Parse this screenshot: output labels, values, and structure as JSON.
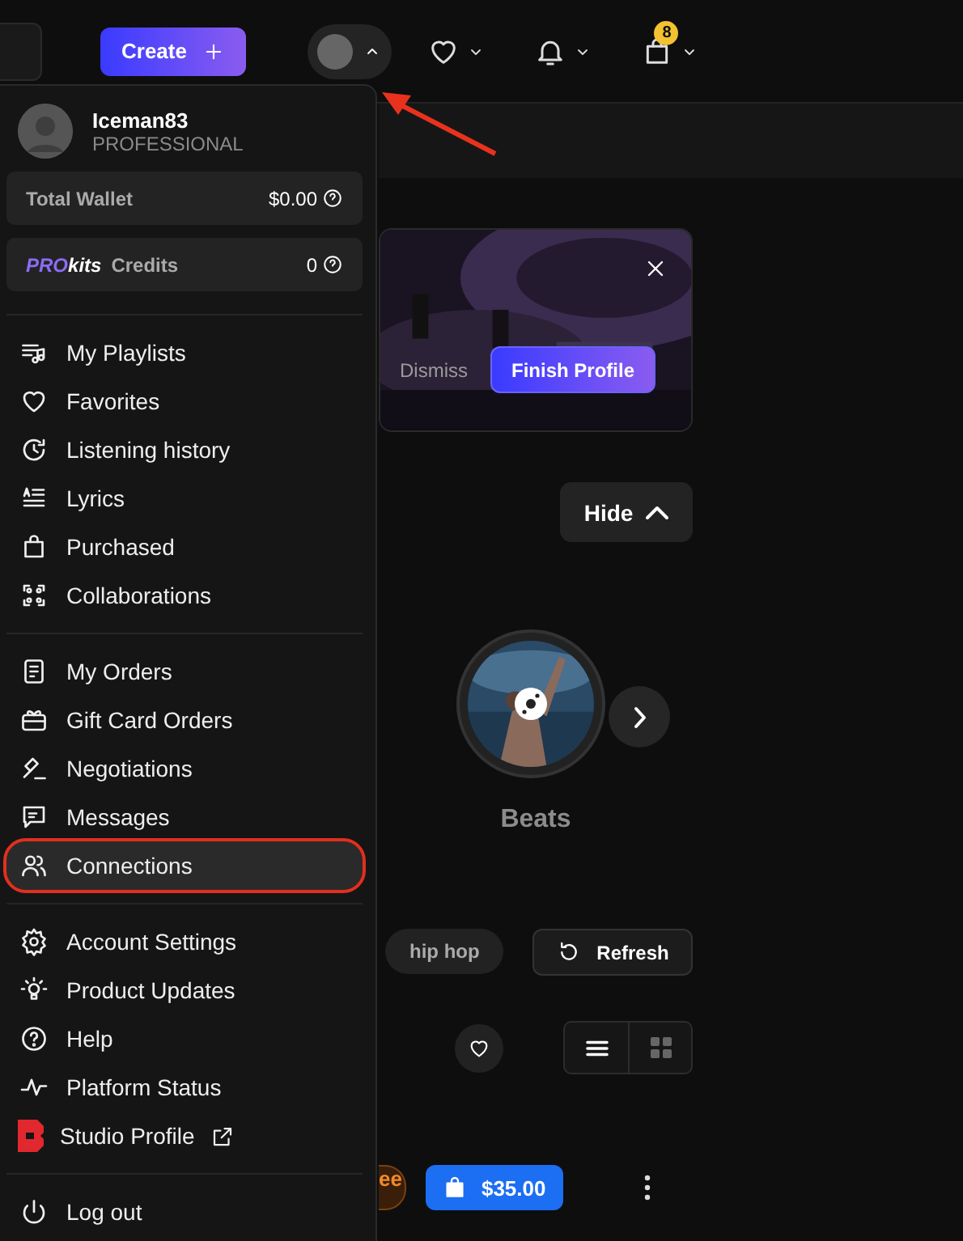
{
  "header": {
    "create_label": "Create",
    "cart_count": "8",
    "account_menu_expanded": true
  },
  "menu": {
    "user": {
      "name": "Iceman83",
      "plan": "PROFESSIONAL"
    },
    "wallet": {
      "label": "Total Wallet",
      "value": "$0.00"
    },
    "credits": {
      "brand_prefix": "PRO",
      "brand_suffix": "kits",
      "label": "Credits",
      "value": "0"
    },
    "sections": [
      [
        {
          "label": "My Playlists",
          "selected": false
        },
        {
          "label": "Favorites",
          "selected": false
        },
        {
          "label": "Listening history",
          "selected": false
        },
        {
          "label": "Lyrics",
          "selected": false
        },
        {
          "label": "Purchased",
          "selected": false
        },
        {
          "label": "Collaborations",
          "selected": false
        }
      ],
      [
        {
          "label": "My Orders",
          "selected": false
        },
        {
          "label": "Gift Card Orders",
          "selected": false
        },
        {
          "label": "Negotiations",
          "selected": false
        },
        {
          "label": "Messages",
          "selected": false
        },
        {
          "label": "Connections",
          "selected": true
        }
      ],
      [
        {
          "label": "Account Settings",
          "selected": false
        },
        {
          "label": "Product Updates",
          "selected": false
        },
        {
          "label": "Help",
          "selected": false
        },
        {
          "label": "Platform Status",
          "selected": false
        },
        {
          "label": "Studio Profile",
          "selected": false,
          "external": true
        }
      ],
      [
        {
          "label": "Log out",
          "selected": false
        }
      ]
    ]
  },
  "profile_banner": {
    "kind": "picture",
    "dismiss": "Dismiss",
    "finish": "Finish Profile"
  },
  "hide_label": "Hide",
  "carousel": {
    "kind": "picture",
    "label": "Beats"
  },
  "filters": {
    "tag": "hip hop",
    "refresh": "Refresh"
  },
  "view_toggle": [
    {
      "selected": true
    },
    {
      "selected": false
    }
  ],
  "product": {
    "badge": "ee",
    "price": "$35.00"
  }
}
